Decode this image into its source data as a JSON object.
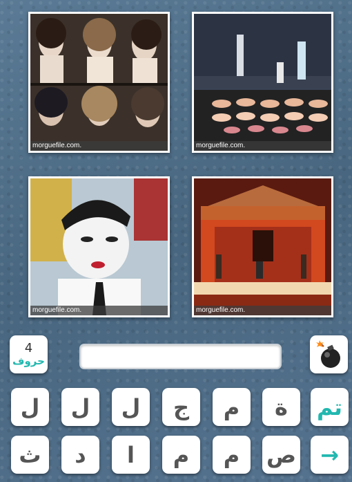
{
  "images": [
    {
      "credit": "morguefile.com."
    },
    {
      "credit": "morguefile.com."
    },
    {
      "credit": "morguefile.com."
    },
    {
      "credit": "morguefile.com."
    }
  ],
  "hint": {
    "number": "4",
    "word": "حروف"
  },
  "answer": {
    "value": ""
  },
  "bomb_icon": "bomb-icon",
  "keys_row1": [
    "تم",
    "ة",
    "م",
    "ج",
    "ل",
    "ل",
    "ل"
  ],
  "keys_row2": [
    "→",
    "ص",
    "م",
    "م",
    "ا",
    "د",
    "ث"
  ],
  "colors": {
    "accent": "#22b8b0",
    "background": "#4f6d87"
  }
}
